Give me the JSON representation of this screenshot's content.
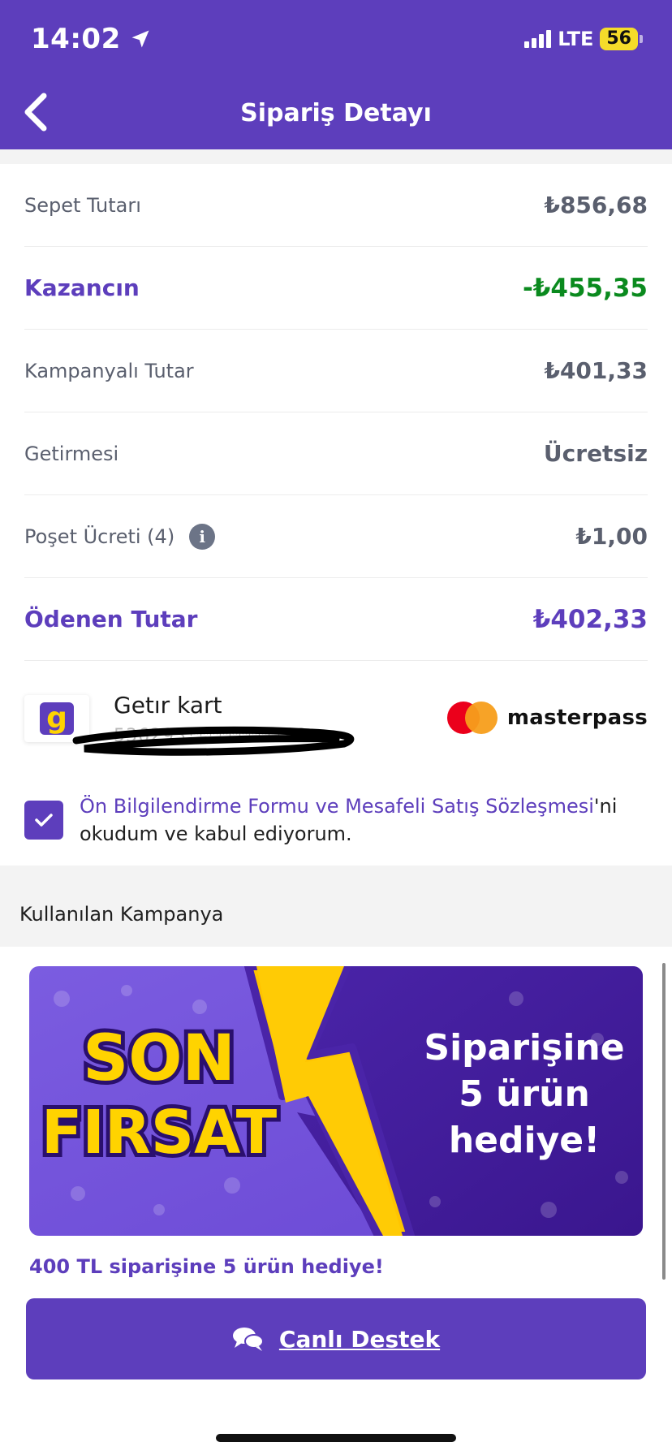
{
  "status_bar": {
    "time": "14:02",
    "network": "LTE",
    "battery": "56"
  },
  "header": {
    "title": "Sipariş Detayı",
    "back_icon": "chevron-left-icon"
  },
  "summary": {
    "rows": [
      {
        "label": "Sepet Tutarı",
        "value": "₺856,68"
      },
      {
        "label": "Kazancın",
        "value": "-₺455,35"
      },
      {
        "label": "Kampanyalı Tutar",
        "value": "₺401,33"
      },
      {
        "label": "Getirmesi",
        "value": "Ücretsiz"
      },
      {
        "label": "Poşet Ücreti (4)",
        "value": "₺1,00"
      },
      {
        "label": "Ödenen Tutar",
        "value": "₺402,33"
      }
    ]
  },
  "payment": {
    "card_name": "Getır kart",
    "card_number_masked": "536293**********82",
    "provider": "masterpass"
  },
  "consent": {
    "link_text": "Ön Bilgilendirme Formu ve Mesafeli Satış Sözleşmesi",
    "suffix_first": "'ni",
    "suffix_rest": "okudum ve kabul ediyorum.",
    "checked": true
  },
  "campaign": {
    "section_title": "Kullanılan Kampanya",
    "banner_line1": "SON",
    "banner_line2": "FIRSAT",
    "banner_right1": "Siparişine",
    "banner_right2": "5 ürün",
    "banner_right3": "hediye!",
    "caption": "400 TL siparişine 5 ürün hediye!"
  },
  "actions": {
    "support_label": "Canlı Destek",
    "support_icon": "chat-bubbles-icon"
  },
  "colors": {
    "brand_purple": "#5d3ebc",
    "gain_green": "#0a8a1e",
    "brand_yellow": "#ffd300"
  }
}
